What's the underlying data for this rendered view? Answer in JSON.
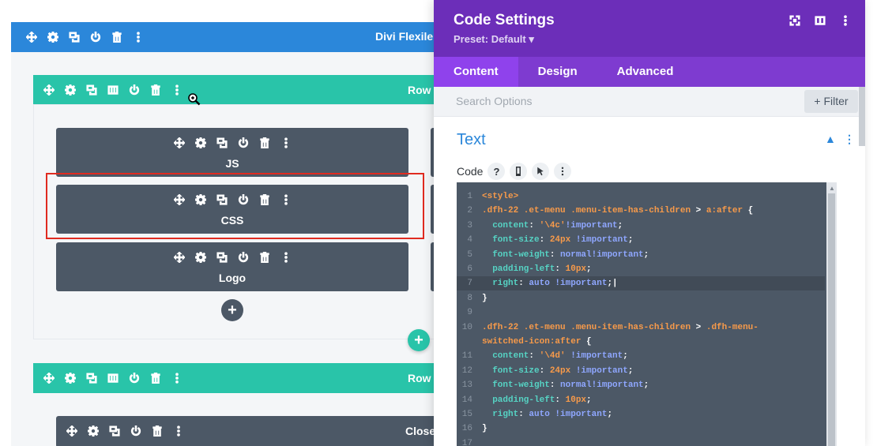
{
  "builder": {
    "section_title": "Divi Flexile He",
    "row1_title": "Row",
    "row2_title": "Row",
    "modules": [
      {
        "label": "JS"
      },
      {
        "label": "CSS"
      },
      {
        "label": "Logo"
      }
    ],
    "bottom_module_title": "Close",
    "add_module_label": "+",
    "add_row_label": "+"
  },
  "panel": {
    "title": "Code Settings",
    "preset": "Preset: Default ▾",
    "tabs": [
      {
        "label": "Content",
        "active": true
      },
      {
        "label": "Design",
        "active": false
      },
      {
        "label": "Advanced",
        "active": false
      }
    ],
    "search_placeholder": "Search Options",
    "filter_label": "+ Filter",
    "toggle_title": "Text",
    "field_label": "Code",
    "help_icon": "?"
  },
  "colors": {
    "section": "#2b87da",
    "row": "#29c4a9",
    "module": "#4c5866",
    "panel_header": "#6c2eb9",
    "tabs": "#7e3bd0",
    "highlight": "#e02b20"
  },
  "code_lines": [
    {
      "n": "1",
      "tokens": [
        [
          "tag",
          "<style>"
        ]
      ]
    },
    {
      "n": "2",
      "tokens": [
        [
          "sel",
          ".dfh-22 .et-menu .menu-item-has-children "
        ],
        [
          "punc",
          "> "
        ],
        [
          "sel",
          "a:after "
        ],
        [
          "punc",
          "{"
        ]
      ]
    },
    {
      "n": "3",
      "tokens": [
        [
          "prop",
          "  content"
        ],
        [
          "punc",
          ": "
        ],
        [
          "str",
          "'\\4c'"
        ],
        [
          "kw",
          "!important"
        ],
        [
          "punc",
          ";"
        ]
      ]
    },
    {
      "n": "4",
      "tokens": [
        [
          "prop",
          "  font-size"
        ],
        [
          "punc",
          ": "
        ],
        [
          "num",
          "24px"
        ],
        [
          "kw",
          " !important"
        ],
        [
          "punc",
          ";"
        ]
      ]
    },
    {
      "n": "5",
      "tokens": [
        [
          "prop",
          "  font-weight"
        ],
        [
          "punc",
          ": "
        ],
        [
          "kw",
          "normal!important"
        ],
        [
          "punc",
          ";"
        ]
      ]
    },
    {
      "n": "6",
      "tokens": [
        [
          "prop",
          "  padding-left"
        ],
        [
          "punc",
          ": "
        ],
        [
          "num",
          "10px"
        ],
        [
          "punc",
          ";"
        ]
      ]
    },
    {
      "n": "7",
      "tokens": [
        [
          "prop",
          "  right"
        ],
        [
          "punc",
          ": "
        ],
        [
          "kw",
          "auto !important"
        ],
        [
          "punc",
          ";|"
        ]
      ],
      "active": true
    },
    {
      "n": "8",
      "tokens": [
        [
          "punc",
          "}"
        ]
      ]
    },
    {
      "n": "9",
      "tokens": []
    },
    {
      "n": "10",
      "tokens": [
        [
          "sel",
          ".dfh-22 .et-menu .menu-item-has-children "
        ],
        [
          "punc",
          "> "
        ],
        [
          "sel",
          ".dfh-menu-"
        ]
      ]
    },
    {
      "n": "",
      "tokens": [
        [
          "sel",
          "switched-icon:after "
        ],
        [
          "punc",
          "{"
        ]
      ]
    },
    {
      "n": "11",
      "tokens": [
        [
          "prop",
          "  content"
        ],
        [
          "punc",
          ": "
        ],
        [
          "str",
          "'\\4d'"
        ],
        [
          "kw",
          " !important"
        ],
        [
          "punc",
          ";"
        ]
      ]
    },
    {
      "n": "12",
      "tokens": [
        [
          "prop",
          "  font-size"
        ],
        [
          "punc",
          ": "
        ],
        [
          "num",
          "24px"
        ],
        [
          "kw",
          " !important"
        ],
        [
          "punc",
          ";"
        ]
      ]
    },
    {
      "n": "13",
      "tokens": [
        [
          "prop",
          "  font-weight"
        ],
        [
          "punc",
          ": "
        ],
        [
          "kw",
          "normal!important"
        ],
        [
          "punc",
          ";"
        ]
      ]
    },
    {
      "n": "14",
      "tokens": [
        [
          "prop",
          "  padding-left"
        ],
        [
          "punc",
          ": "
        ],
        [
          "num",
          "10px"
        ],
        [
          "punc",
          ";"
        ]
      ]
    },
    {
      "n": "15",
      "tokens": [
        [
          "prop",
          "  right"
        ],
        [
          "punc",
          ": "
        ],
        [
          "kw",
          "auto !important"
        ],
        [
          "punc",
          ";"
        ]
      ]
    },
    {
      "n": "16",
      "tokens": [
        [
          "punc",
          "}"
        ]
      ]
    },
    {
      "n": "17",
      "tokens": []
    }
  ]
}
